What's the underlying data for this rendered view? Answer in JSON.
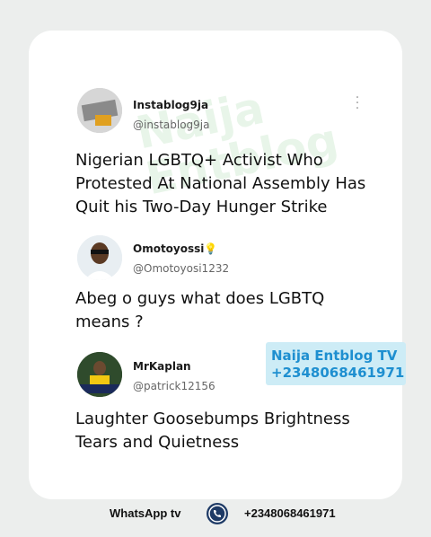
{
  "watermark": {
    "line1": "Naija",
    "line2": "Entblog"
  },
  "posts": [
    {
      "name": "Instablog9ja",
      "handle": "@instablog9ja",
      "text": [
        "Nigerian LGBTQ+ Activist Who",
        "Protested At National Assembly Has",
        "Quit his Two-Day Hunger Strike"
      ]
    },
    {
      "name": "Omotoyossi",
      "handle": "@Omotoyosi1232",
      "text": [
        "Abeg o guys what does LGBTQ",
        "means ?"
      ]
    },
    {
      "name": "MrKaplan",
      "handle": "@patrick12156",
      "text": [
        "Laughter Goosebumps Brightness",
        "Tears and Quietness"
      ]
    }
  ],
  "overlay": {
    "line1": "Naija Entblog TV",
    "line2": "+2348068461971"
  },
  "footer": {
    "left": "WhatsApp tv",
    "right": "+2348068461971"
  },
  "icons": {
    "name_badge": "lightbulb-emoji",
    "more": "vertical-dots-icon",
    "footer": "phone-icon"
  },
  "colors": {
    "overlay_bg": "#cdecf6",
    "overlay_text": "#1e8fd0",
    "footer_icon": "#1e3a66"
  }
}
